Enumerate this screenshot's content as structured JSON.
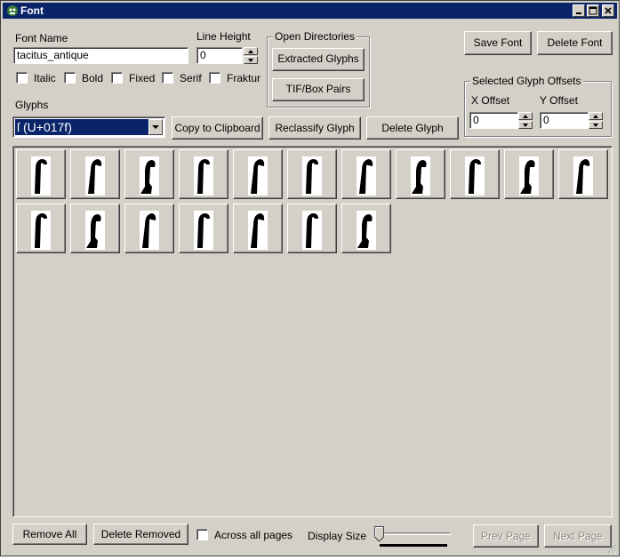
{
  "window": {
    "title": "Font",
    "app_icon": "font-tool-icon"
  },
  "titlebar_buttons": [
    "minimize",
    "maximize",
    "close"
  ],
  "font_name": {
    "label": "Font Name",
    "value": "tacitus_antique"
  },
  "line_height": {
    "label": "Line Height",
    "value": "0"
  },
  "style_checkboxes": [
    {
      "label": "Italic",
      "checked": false
    },
    {
      "label": "Bold",
      "checked": false
    },
    {
      "label": "Fixed",
      "checked": false
    },
    {
      "label": "Serif",
      "checked": false
    },
    {
      "label": "Fraktur",
      "checked": false
    }
  ],
  "open_directories": {
    "title": "Open Directories",
    "extracted_glyphs": "Extracted Glyphs",
    "tif_box_pairs": "TIF/Box Pairs"
  },
  "actions": {
    "save_font": "Save Font",
    "delete_font": "Delete Font"
  },
  "glyph_offsets": {
    "title": "Selected Glyph Offsets",
    "x_label": "X Offset",
    "x_value": "0",
    "y_label": "Y Offset",
    "y_value": "0"
  },
  "glyphs": {
    "label": "Glyphs",
    "selected": "ſ (U+017f)"
  },
  "glyph_actions": {
    "copy": "Copy to Clipboard",
    "reclassify": "Reclassify Glyph",
    "delete": "Delete Glyph"
  },
  "glyph_tiles": [
    {
      "variant": "a"
    },
    {
      "variant": "b"
    },
    {
      "variant": "c"
    },
    {
      "variant": "a"
    },
    {
      "variant": "b"
    },
    {
      "variant": "a"
    },
    {
      "variant": "b"
    },
    {
      "variant": "c"
    },
    {
      "variant": "a"
    },
    {
      "variant": "c"
    },
    {
      "variant": "b"
    },
    {
      "variant": "a"
    },
    {
      "variant": "c"
    },
    {
      "variant": "b"
    },
    {
      "variant": "a"
    },
    {
      "variant": "b"
    },
    {
      "variant": "a"
    },
    {
      "variant": "c"
    }
  ],
  "bottom": {
    "remove_all": "Remove All",
    "delete_removed": "Delete Removed",
    "across_all_pages": "Across all pages",
    "across_all_pages_checked": false,
    "display_size_label": "Display Size",
    "display_size_level": 0,
    "prev_page": "Prev Page",
    "next_page": "Next Page"
  }
}
